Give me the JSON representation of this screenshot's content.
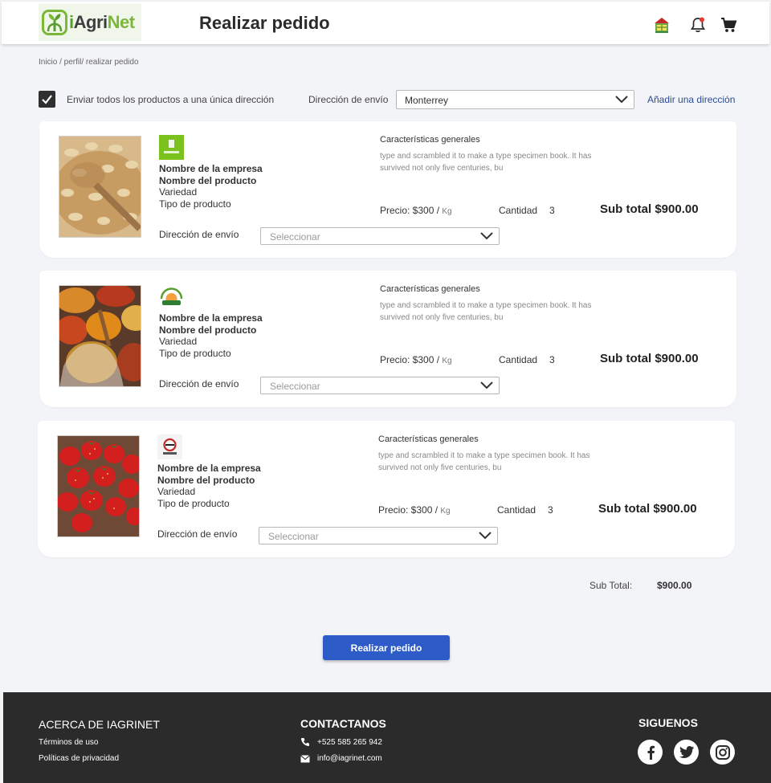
{
  "header": {
    "logo_text_i": "i",
    "logo_text_agri": "Agri",
    "logo_text_net": "Net",
    "title": "Realizar pedido",
    "icons": [
      "farm-icon",
      "bell-icon",
      "cart-icon"
    ],
    "notification_color": "#e53935"
  },
  "breadcrumb": "Inicio / perfil/ realizar pedido",
  "shipping": {
    "single_address_checked": true,
    "single_address_label": "Enviar todos los productos a una única dirección",
    "address_label": "Dirección de envío",
    "address_value": "Monterrey",
    "add_address_link": "Añadir una dirección"
  },
  "products": [
    {
      "image": "oats",
      "company_logo": "green-box-logo",
      "company": "Nombre de la empresa",
      "product": "Nombre del producto",
      "variety": "Variedad",
      "type": "Tipo de producto",
      "features_title": "Características generales",
      "features_text": "type and scrambled it to make a type specimen book. It has survived not only five centuries, bu",
      "price_label": "Precio: $300 /",
      "price_unit": "Kg",
      "qty_label": "Cantidad",
      "qty_value": "3",
      "subtotal": "Sub total $900.00",
      "address_label": "Dirección de envío",
      "address_placeholder": "Seleccionar"
    },
    {
      "image": "spices",
      "company_logo": "farm-arc-logo",
      "company": "Nombre de la empresa",
      "product": "Nombre del producto",
      "variety": "Variedad",
      "type": "Tipo de producto",
      "features_title": "Características generales",
      "features_text": "type and scrambled it to make a type specimen book. It has survived not only five centuries, bu",
      "price_label": "Precio: $300 /",
      "price_unit": "Kg",
      "qty_label": "Cantidad",
      "qty_value": "3",
      "subtotal": "Sub total $900.00",
      "address_label": "Dirección de envío",
      "address_placeholder": "Seleccionar"
    },
    {
      "image": "strawberries",
      "company_logo": "round-badge-logo",
      "company": "Nombre de la empresa",
      "product": "Nombre del producto",
      "variety": "Variedad",
      "type": "Tipo de producto",
      "features_title": "Características generales",
      "features_text": "type and scrambled it to make a type specimen book. It has survived not only five centuries, bu",
      "price_label": "Precio: $300 /",
      "price_unit": "Kg",
      "qty_label": "Cantidad",
      "qty_value": "3",
      "subtotal": "Sub total $900.00",
      "address_label": "Dirección de envío",
      "address_placeholder": "Seleccionar"
    }
  ],
  "summary": {
    "label": "Sub Total:",
    "value": "$900.00"
  },
  "order_button": "Realizar pedido",
  "footer": {
    "about_title": "ACERCA DE IAGRINET",
    "terms": "Términos de uso",
    "privacy": "Políticas de privacidad",
    "contact_title": "CONTACTANOS",
    "phone": "+525 585 265 942",
    "email": "info@iagrinet.com",
    "social_title": "SIGUENOS",
    "social_icons": [
      "facebook-icon",
      "twitter-icon",
      "instagram-icon"
    ]
  },
  "colors": {
    "primary": "#2d5cc8",
    "brand_green": "#7ab937",
    "link": "#2d4b8e",
    "footer_bg": "#2b2b2b",
    "page_bg": "#f3f4f8"
  }
}
